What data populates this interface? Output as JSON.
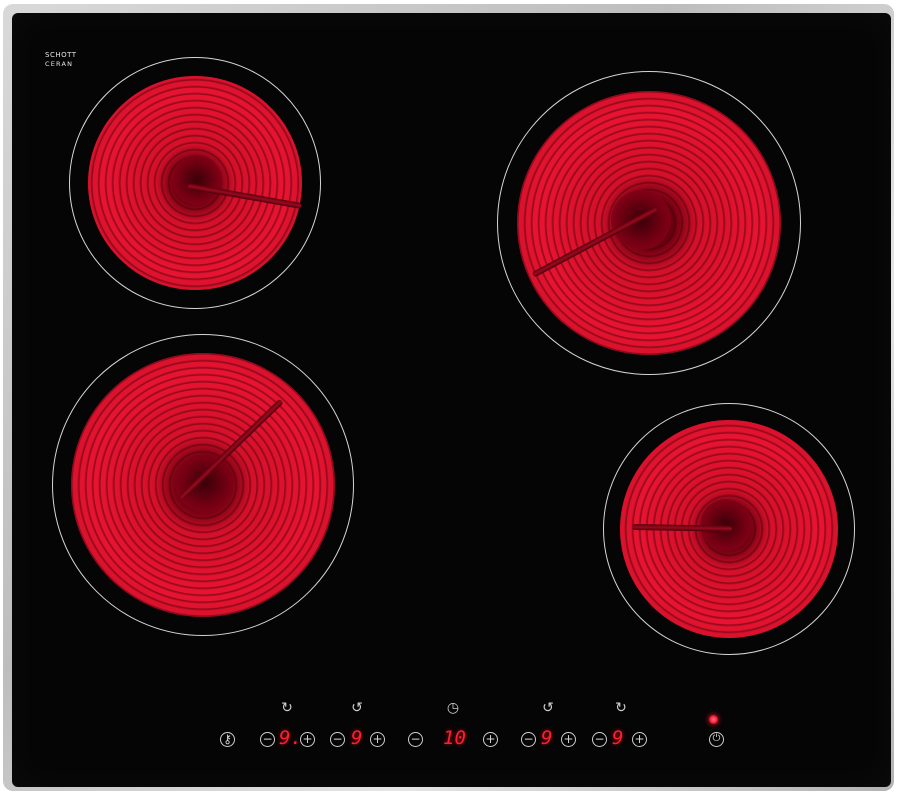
{
  "logo": {
    "line1": "SCHOTT",
    "line2": "CERAN"
  },
  "zones": [
    {
      "id": "rear-left",
      "state": "on"
    },
    {
      "id": "rear-right",
      "state": "on"
    },
    {
      "id": "front-left",
      "state": "on"
    },
    {
      "id": "front-right",
      "state": "on"
    }
  ],
  "controls": {
    "lock_icon": "key-icon",
    "zone_selector_icons": [
      "zone-rear-left-icon",
      "zone-front-left-icon",
      "zone-front-right-icon",
      "zone-rear-right-icon"
    ],
    "timer_icon": "clock-icon",
    "minus_symbol": "−",
    "plus_symbol": "+",
    "levels": [
      "9.",
      "9",
      "9",
      "9"
    ],
    "timer_value": "10",
    "power_icon": "power-icon"
  },
  "colors": {
    "display": "#ff1e2e",
    "glass": "#050505",
    "heat": "#e81431",
    "frame": "#c8c8c8"
  }
}
